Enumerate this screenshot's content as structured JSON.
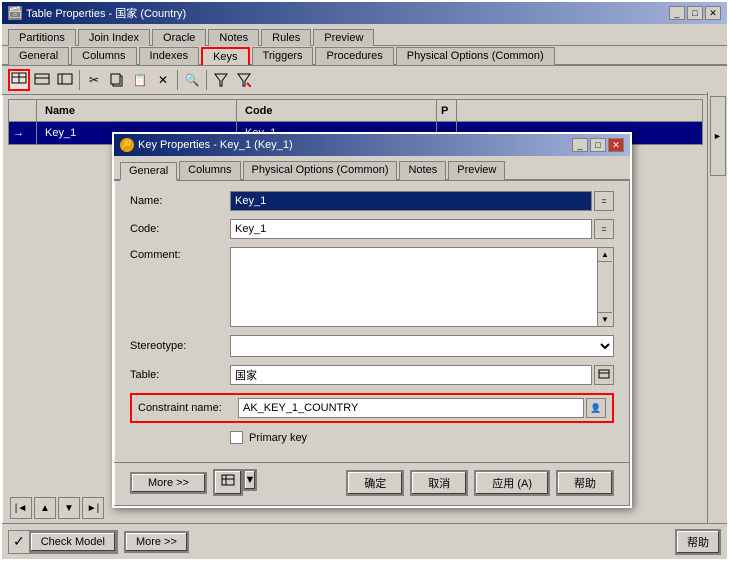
{
  "outerWindow": {
    "title": "Table Properties - 国家 (Country)",
    "titleIcon": "🗃"
  },
  "outerTabs": {
    "row1": [
      "Partitions",
      "Join Index",
      "Oracle",
      "Notes",
      "Rules",
      "Preview"
    ],
    "row2": [
      "General",
      "Columns",
      "Indexes",
      "Keys",
      "Triggers",
      "Procedures",
      "Physical Options (Common)"
    ],
    "activeTab": "Keys"
  },
  "toolbar": {
    "buttons": [
      "new-table-icon",
      "new-key-icon",
      "new-item-icon",
      "cut-icon",
      "copy-icon",
      "paste-icon",
      "delete-icon",
      "find-icon",
      "filter-icon",
      "filter-clear-icon"
    ]
  },
  "grid": {
    "headers": [
      "Name",
      "Code",
      "P"
    ],
    "rows": [
      {
        "arrow": "→",
        "name": "Key_1",
        "code": "Key_1",
        "p": ""
      }
    ]
  },
  "dialog": {
    "title": "Key Properties - Key_1 (Key_1)",
    "tabs": [
      "General",
      "Columns",
      "Physical Options (Common)",
      "Notes",
      "Preview"
    ],
    "activeTab": "General",
    "form": {
      "nameLabel": "Name:",
      "nameValue": "Key_1",
      "codeLabel": "Code:",
      "codeValue": "Key_1",
      "commentLabel": "Comment:",
      "commentValue": "",
      "stereotypeLabel": "Stereotype:",
      "stereotypeValue": "",
      "tableLabel": "Table:",
      "tableValue": "国家",
      "constraintLabel": "Constraint name:",
      "constraintValue": "AK_KEY_1_COUNTRY",
      "primaryKeyLabel": "Primary key",
      "primaryKeyChecked": false
    },
    "buttons": {
      "more": "More >>",
      "confirm": "确定",
      "cancel": "取消",
      "apply": "应用 (A)",
      "help": "帮助"
    }
  },
  "outerBottom": {
    "moreLabel": "More >>",
    "checkModelLabel": "Check Model",
    "helpLabel": "帮助"
  }
}
